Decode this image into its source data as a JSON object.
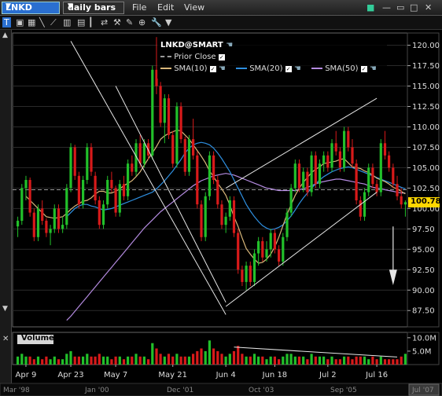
{
  "header": {
    "symbol": "LNKD",
    "period": "daily bars",
    "menus": [
      "File",
      "Edit",
      "View"
    ]
  },
  "legend": {
    "title": "LNKD@SMART",
    "items": [
      {
        "label": "Prior Close",
        "color": "#9a9a9a",
        "style": "dashed"
      },
      {
        "label": "SMA(10)",
        "color": "#d9b77a"
      },
      {
        "label": "SMA(20)",
        "color": "#2e8fe0"
      },
      {
        "label": "SMA(50)",
        "color": "#b48be0"
      }
    ]
  },
  "volume_label": "Volume",
  "last_price_label": "100.78",
  "chart_data": {
    "type": "candlestick",
    "symbol": "LNKD",
    "ylim": [
      85.5,
      121.5
    ],
    "y_ticks": [
      87.5,
      90.0,
      92.5,
      95.0,
      97.5,
      100.0,
      102.5,
      105.0,
      107.5,
      110.0,
      112.5,
      115.0,
      117.5,
      120.0
    ],
    "x_ticks": [
      "Apr 9",
      "Apr 23",
      "May 7",
      "May 21",
      "Jun 4",
      "Jun 18",
      "Jul 2",
      "Jul 16"
    ],
    "overview_ticks": [
      "Mar '98",
      "Jan '00",
      "Dec '01",
      "Oct '03",
      "Sep '05",
      "Jul '07"
    ],
    "prior_close": 102.3,
    "last_price": 100.78,
    "volume_ylim": [
      0,
      12
    ],
    "volume_ticks": [
      "10.0M",
      "5.0M"
    ],
    "volume_tick_values": [
      10,
      5
    ],
    "colors": {
      "up": "#22c02a",
      "down": "#d81a1a",
      "sma10": "#d9b77a",
      "sma20": "#2e8fe0",
      "sma50": "#b48be0",
      "lines": "#e6e6e6",
      "price_flag": "#ffd700"
    },
    "candles": [
      [
        97.8,
        99.0,
        96.5,
        98.5
      ],
      [
        98.5,
        103.0,
        98.0,
        102.5
      ],
      [
        102.5,
        104.0,
        101.0,
        103.5
      ],
      [
        103.5,
        103.8,
        99.0,
        99.5
      ],
      [
        99.5,
        100.0,
        96.0,
        96.5
      ],
      [
        96.5,
        100.5,
        96.0,
        100.0
      ],
      [
        100.0,
        101.0,
        98.0,
        98.5
      ],
      [
        98.5,
        98.8,
        96.5,
        97.0
      ],
      [
        97.0,
        98.0,
        95.5,
        97.5
      ],
      [
        97.5,
        100.5,
        97.0,
        100.0
      ],
      [
        100.0,
        100.5,
        97.0,
        97.5
      ],
      [
        97.5,
        99.0,
        97.0,
        98.0
      ],
      [
        98.0,
        103.0,
        97.5,
        102.5
      ],
      [
        102.5,
        108.0,
        102.0,
        107.5
      ],
      [
        107.5,
        107.8,
        103.5,
        104.0
      ],
      [
        104.0,
        104.5,
        100.0,
        100.5
      ],
      [
        100.5,
        104.0,
        100.0,
        103.5
      ],
      [
        103.5,
        108.0,
        103.0,
        107.5
      ],
      [
        107.5,
        108.0,
        104.0,
        104.5
      ],
      [
        104.0,
        104.5,
        100.5,
        101.0
      ],
      [
        101.0,
        101.5,
        97.5,
        98.0
      ],
      [
        98.0,
        101.0,
        97.5,
        100.5
      ],
      [
        100.5,
        104.0,
        100.0,
        103.5
      ],
      [
        103.5,
        104.5,
        102.0,
        102.5
      ],
      [
        102.5,
        102.8,
        99.0,
        99.5
      ],
      [
        99.5,
        103.5,
        99.0,
        103.0
      ],
      [
        103.0,
        104.0,
        101.0,
        101.5
      ],
      [
        101.5,
        106.0,
        101.0,
        105.5
      ],
      [
        105.5,
        106.5,
        104.0,
        104.5
      ],
      [
        104.5,
        108.5,
        104.0,
        108.0
      ],
      [
        108.0,
        109.0,
        105.0,
        105.5
      ],
      [
        105.5,
        108.5,
        105.0,
        108.0
      ],
      [
        108.0,
        108.5,
        106.0,
        106.5
      ],
      [
        106.5,
        117.5,
        106.0,
        117.0
      ],
      [
        117.0,
        121.0,
        114.0,
        115.0
      ],
      [
        115.0,
        115.5,
        110.0,
        110.5
      ],
      [
        110.5,
        114.0,
        108.0,
        113.5
      ],
      [
        113.5,
        114.0,
        108.5,
        109.0
      ],
      [
        109.0,
        109.5,
        105.0,
        105.5
      ],
      [
        105.5,
        113.0,
        105.0,
        112.5
      ],
      [
        112.5,
        113.0,
        108.0,
        108.5
      ],
      [
        108.5,
        108.8,
        104.0,
        104.5
      ],
      [
        104.5,
        109.0,
        104.0,
        108.5
      ],
      [
        108.5,
        111.0,
        106.0,
        106.5
      ],
      [
        106.5,
        107.0,
        100.0,
        100.5
      ],
      [
        100.5,
        101.0,
        96.0,
        96.5
      ],
      [
        96.5,
        102.0,
        96.0,
        101.5
      ],
      [
        101.5,
        107.0,
        101.0,
        106.5
      ],
      [
        106.5,
        107.0,
        103.0,
        103.5
      ],
      [
        103.5,
        104.0,
        100.0,
        100.5
      ],
      [
        100.5,
        101.0,
        97.5,
        98.0
      ],
      [
        98.0,
        99.5,
        97.0,
        99.0
      ],
      [
        99.0,
        101.5,
        98.5,
        101.0
      ],
      [
        101.0,
        101.5,
        96.5,
        97.0
      ],
      [
        97.0,
        97.5,
        92.0,
        92.5
      ],
      [
        92.5,
        93.0,
        90.5,
        91.0
      ],
      [
        91.0,
        93.5,
        90.0,
        93.0
      ],
      [
        93.0,
        93.5,
        90.5,
        91.0
      ],
      [
        91.0,
        95.0,
        90.5,
        94.5
      ],
      [
        94.5,
        96.5,
        93.0,
        96.0
      ],
      [
        96.0,
        96.5,
        93.5,
        94.0
      ],
      [
        94.0,
        96.0,
        93.5,
        95.0
      ],
      [
        95.0,
        97.5,
        94.0,
        97.0
      ],
      [
        97.0,
        97.5,
        94.5,
        95.0
      ],
      [
        95.0,
        95.5,
        93.0,
        93.5
      ],
      [
        93.5,
        97.0,
        93.0,
        96.5
      ],
      [
        96.5,
        100.0,
        96.0,
        99.5
      ],
      [
        99.5,
        103.0,
        99.0,
        102.5
      ],
      [
        102.5,
        106.0,
        102.0,
        105.5
      ],
      [
        105.5,
        106.0,
        102.0,
        102.5
      ],
      [
        102.5,
        105.0,
        102.0,
        104.5
      ],
      [
        104.5,
        105.0,
        101.5,
        102.0
      ],
      [
        102.0,
        107.0,
        101.5,
        106.5
      ],
      [
        106.5,
        107.0,
        102.5,
        103.0
      ],
      [
        103.0,
        106.0,
        102.5,
        105.5
      ],
      [
        105.5,
        107.0,
        104.5,
        106.5
      ],
      [
        106.5,
        107.0,
        104.5,
        105.0
      ],
      [
        105.0,
        108.5,
        104.5,
        108.0
      ],
      [
        108.0,
        109.5,
        106.5,
        107.0
      ],
      [
        107.0,
        107.5,
        104.5,
        105.0
      ],
      [
        105.0,
        110.0,
        104.5,
        109.5
      ],
      [
        109.5,
        110.0,
        107.0,
        107.5
      ],
      [
        107.5,
        108.5,
        105.0,
        105.5
      ],
      [
        105.5,
        106.0,
        100.5,
        101.0
      ],
      [
        101.0,
        101.5,
        98.5,
        99.0
      ],
      [
        99.0,
        102.5,
        98.5,
        102.0
      ],
      [
        102.0,
        105.5,
        101.5,
        105.0
      ],
      [
        105.0,
        105.5,
        102.5,
        103.0
      ],
      [
        103.0,
        103.5,
        101.5,
        102.0
      ],
      [
        102.0,
        108.5,
        101.5,
        108.0
      ],
      [
        108.0,
        109.5,
        106.0,
        106.5
      ],
      [
        106.5,
        107.0,
        104.5,
        105.0
      ],
      [
        105.0,
        105.5,
        102.5,
        103.0
      ],
      [
        103.0,
        104.0,
        101.0,
        101.5
      ],
      [
        101.5,
        102.5,
        100.0,
        100.5
      ],
      [
        100.5,
        101.0,
        99.0,
        100.78
      ]
    ],
    "volume": [
      3,
      4,
      3,
      3,
      2,
      3,
      2,
      3,
      2,
      3,
      2,
      2,
      4,
      5,
      3,
      3,
      3,
      4,
      3,
      3,
      4,
      3,
      3,
      2,
      3,
      3,
      2,
      3,
      3,
      4,
      3,
      3,
      2,
      8,
      6,
      4,
      3,
      4,
      3,
      4,
      3,
      3,
      3,
      4,
      5,
      6,
      5,
      9,
      6,
      5,
      4,
      3,
      4,
      5,
      7,
      4,
      3,
      3,
      4,
      3,
      3,
      2,
      3,
      3,
      2,
      3,
      4,
      4,
      3,
      3,
      3,
      2,
      4,
      3,
      3,
      3,
      2,
      3,
      2,
      2,
      3,
      3,
      2,
      3,
      3,
      3,
      2,
      3,
      2,
      3,
      2,
      2,
      2,
      2,
      3,
      4
    ],
    "sma10": [
      101.5,
      101.0,
      100.5,
      100.0,
      99.5,
      99.0,
      98.9,
      98.8,
      98.9,
      99.0,
      99.4,
      99.9,
      100.3,
      100.6,
      100.9,
      101.0,
      101.3,
      101.8,
      102.1,
      102.1,
      101.9,
      101.9,
      102.1,
      102.4,
      102.8,
      103.1,
      103.4,
      103.9,
      104.5,
      105.3,
      106.1,
      106.8,
      107.6,
      108.5,
      108.9,
      109.2,
      109.4,
      109.6,
      109.5,
      109.0,
      108.5,
      107.8,
      107.1,
      106.4,
      105.6,
      104.6,
      103.9,
      103.1,
      102.4,
      101.6,
      100.4,
      99.0,
      97.8,
      96.4,
      95.1,
      94.4,
      93.8,
      93.3,
      93.4,
      93.8,
      94.4,
      95.3,
      96.5,
      97.9,
      99.3,
      100.5,
      101.6,
      102.5,
      103.2,
      103.8,
      104.4,
      104.8,
      105.1,
      105.5,
      105.6,
      105.7,
      105.8,
      106.0,
      106.1,
      105.6,
      105.1,
      105.0,
      104.9,
      104.6,
      104.4,
      104.1,
      103.7,
      103.5,
      103.3,
      103.0,
      102.6,
      102.4,
      102.1,
      101.8
    ],
    "sma20": [
      99.0,
      99.5,
      100.0,
      100.3,
      100.5,
      100.5,
      100.3,
      100.2,
      100.0,
      99.8,
      99.9,
      100.0,
      100.2,
      100.4,
      100.6,
      100.8,
      101.0,
      101.2,
      101.4,
      101.6,
      101.8,
      102.0,
      102.4,
      102.9,
      103.4,
      104.0,
      104.6,
      105.3,
      106.0,
      106.8,
      107.4,
      107.8,
      108.0,
      108.1,
      108.0,
      107.8,
      107.4,
      106.8,
      106.1,
      105.3,
      104.5,
      103.5,
      102.5,
      101.5,
      100.5,
      99.7,
      99.0,
      98.4,
      97.9,
      97.6,
      97.4,
      97.5,
      97.7,
      98.0,
      98.5,
      99.1,
      99.8,
      100.6,
      101.3,
      101.9,
      102.5,
      103.0,
      103.5,
      103.9,
      104.2,
      104.5,
      104.7,
      104.9,
      105.0,
      105.1,
      105.0,
      104.8,
      104.6,
      104.4,
      104.2,
      104.0,
      103.8,
      103.6,
      103.4,
      103.2,
      103.0,
      102.8,
      102.6,
      102.4
    ],
    "sma50": [
      86.3,
      86.8,
      87.4,
      88.0,
      88.6,
      89.2,
      89.8,
      90.4,
      91.0,
      91.6,
      92.2,
      92.8,
      93.4,
      94.0,
      94.6,
      95.2,
      95.8,
      96.4,
      97.0,
      97.6,
      98.1,
      98.6,
      99.1,
      99.6,
      100.0,
      100.4,
      100.8,
      101.2,
      101.6,
      102.0,
      102.4,
      102.8,
      103.1,
      103.4,
      103.6,
      103.8,
      104.0,
      104.1,
      104.2,
      104.3,
      104.2,
      104.1,
      103.9,
      103.7,
      103.5,
      103.3,
      103.1,
      102.9,
      102.7,
      102.5,
      102.4,
      102.3,
      102.2,
      102.2,
      102.2,
      102.2,
      102.2,
      102.3,
      102.4,
      102.6,
      102.8,
      103.0,
      103.2,
      103.3,
      103.4,
      103.5,
      103.6,
      103.6,
      103.5,
      103.4,
      103.3,
      103.2,
      103.1,
      103.0,
      102.8,
      102.6,
      102.5,
      102.4,
      102.3,
      102.2,
      102.1,
      102.0,
      101.9,
      101.9
    ],
    "annotations": [
      {
        "type": "line",
        "from": [
          "Apr 23",
          120.5
        ],
        "to": [
          "Jun 4",
          87.0
        ]
      },
      {
        "type": "line",
        "from": [
          "May 7",
          115.0
        ],
        "to": [
          "Jun 4",
          88.5
        ]
      },
      {
        "type": "line",
        "from": [
          "Jun 4",
          102.5
        ],
        "to": [
          "Jul 16",
          113.5
        ]
      },
      {
        "type": "line",
        "from": [
          "Jun 4",
          88.0
        ],
        "to": [
          "Jul 16",
          102.0
        ]
      }
    ]
  }
}
